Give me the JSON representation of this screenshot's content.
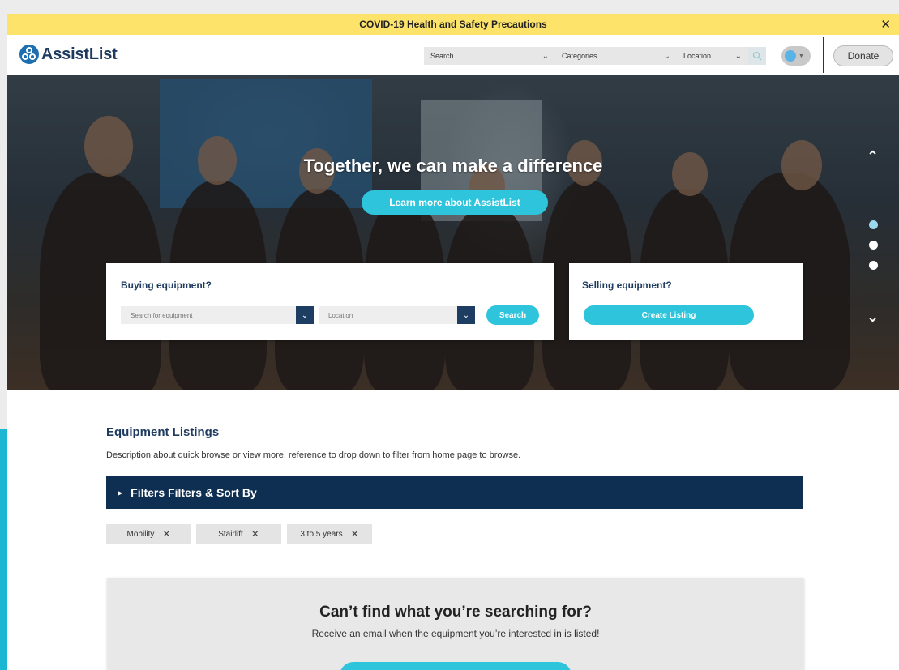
{
  "covid_banner": {
    "text": "COVID-19 Health and Safety Precautions",
    "close_glyph": "✕"
  },
  "header": {
    "logo_text": "AssistList",
    "search_label": "Search",
    "categories_label": "Categories",
    "location_label": "Location",
    "donate_label": "Donate"
  },
  "hero": {
    "title": "Together, we can make a difference",
    "learn_more_label": "Learn more about AssistList",
    "buying": {
      "title": "Buying equipment?",
      "search_placeholder": "Search for equipment",
      "location_placeholder": "Location",
      "search_label": "Search"
    },
    "selling": {
      "title": "Selling equipment?",
      "create_label": "Create Listing"
    },
    "carousel": {
      "slides": 3,
      "active": 1
    }
  },
  "listings": {
    "title": "Equipment Listings",
    "description": "Description about quick browse or view more. reference to drop down to filter from home page to browse.",
    "filter_bar_label": "Filters Filters & Sort By",
    "chips": [
      "Mobility",
      "Stairlift",
      "3 to 5 years"
    ]
  },
  "cta": {
    "title": "Can’t find what you’re searching for?",
    "description": "Receive an email when the equipment you’re interested in is listed!"
  },
  "colors": {
    "navy": "#0f2f52",
    "teal": "#2ec4dc",
    "banner_yellow": "#fde36a",
    "logo_blue": "#1e6fb0"
  }
}
